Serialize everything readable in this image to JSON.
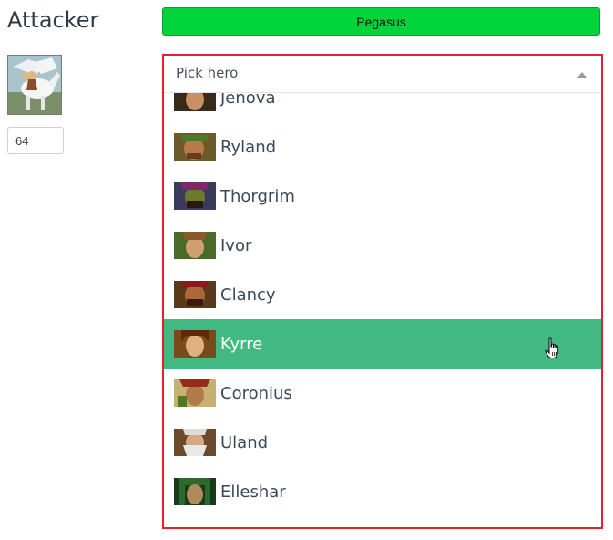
{
  "attacker": {
    "title": "Attacker",
    "creature_button_label": "Pegasus",
    "creature_icon": "pegasus-portrait",
    "count_value": "64"
  },
  "hero_dropdown": {
    "placeholder": "Pick hero",
    "options": [
      {
        "label": "Jenova",
        "icon": "hero-portrait-jenova"
      },
      {
        "label": "Ryland",
        "icon": "hero-portrait-ryland"
      },
      {
        "label": "Thorgrim",
        "icon": "hero-portrait-thorgrim"
      },
      {
        "label": "Ivor",
        "icon": "hero-portrait-ivor"
      },
      {
        "label": "Clancy",
        "icon": "hero-portrait-clancy"
      },
      {
        "label": "Kyrre",
        "icon": "hero-portrait-kyrre"
      },
      {
        "label": "Coronius",
        "icon": "hero-portrait-coronius"
      },
      {
        "label": "Uland",
        "icon": "hero-portrait-uland"
      },
      {
        "label": "Elleshar",
        "icon": "hero-portrait-elleshar"
      },
      {
        "label": "",
        "icon": "hero-portrait-next"
      }
    ],
    "highlighted_label": "Kyrre"
  },
  "colors": {
    "creature_button": "#00d43a",
    "dropdown_border": "#e1222a",
    "option_highlight": "#42b883"
  }
}
